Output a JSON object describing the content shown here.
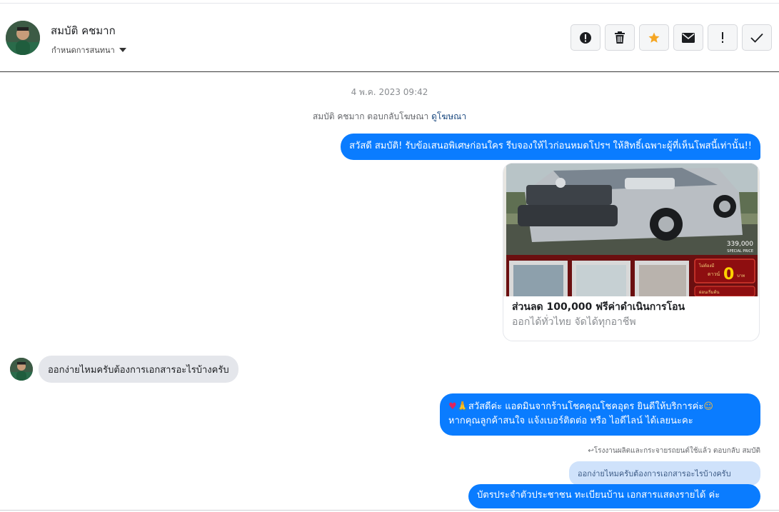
{
  "header": {
    "contact_name": "สมบัติ คชมาก",
    "assign_label": "กำหนดการสนทนา",
    "actions": [
      {
        "name": "report-icon"
      },
      {
        "name": "trash-icon"
      },
      {
        "name": "star-icon",
        "color": "#f5a623"
      },
      {
        "name": "mail-icon"
      },
      {
        "name": "exclamation-icon"
      },
      {
        "name": "check-icon"
      }
    ]
  },
  "thread": {
    "timestamp": "4 พ.ค. 2023 09:42",
    "replied_ad_text": "สมบัติ คชมาก ตอบกลับโฆษณา",
    "view_ad_link": "ดูโฆษณา",
    "msg1": "สวัสดี สมบัติ! รับข้อเสนอพิเศษก่อนใคร รีบจองให้ไวก่อนหมดโปรฯ ให้สิทธิ์เฉพาะผู้ที่เห็นโพสนี้เท่านั้น!!",
    "ad": {
      "price_text": "339,000",
      "price_sub": "SPECIAL PRICE",
      "promo_small": "ไม่ต้องมี",
      "promo_down": "ดาวน์",
      "promo_zero": "0",
      "promo_unit": "บาท",
      "promo_bottom": "ผ่อนเริ่มต้น",
      "title": "ส่วนลด 100,000 ฟรีค่าดำเนินการโอน",
      "subtitle": "ออกได้ทั่วไทย จัดได้ทุกอาชีพ"
    },
    "incoming_msg": "ออกง่ายไหมครับต้องการเอกสารอะไรบ้างครับ",
    "msg2_line1": "สวัสดีค่ะ แอดมินจากร้านโชคคุณโชคอุดร ยินดีให้บริการค่ะ",
    "msg2_line2": "หากคุณลูกค้าสนใจ แจ้งเบอร์ติดต่อ หรือ ไอดีไลน์ ได้เลยนะคะ",
    "reply_note": "โรงงานผลิตและกระจายรถยนต์ใช้แล้ว ตอบกลับ สมบัติ",
    "quoted_text": "ออกง่ายไหมครับต้องการเอกสารอะไรบ้างครับ",
    "msg3": "บัตรประจำตัวประชาชน ทะเบียนบ้าน เอกสารแสดงรายได้ ค่ะ"
  },
  "colors": {
    "bubble_out": "#0a7cff",
    "bubble_in": "#e4e6eb",
    "quote_bg": "#cfe2fb",
    "star": "#f5a623"
  }
}
